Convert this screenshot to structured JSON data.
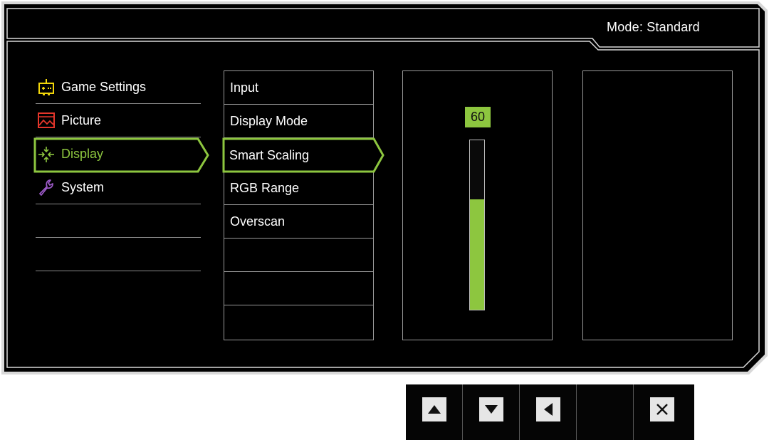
{
  "header": {
    "mode_label": "Mode: Standard"
  },
  "main_menu": {
    "items": [
      {
        "label": "Game Settings",
        "icon": "game-settings-icon",
        "selected": false
      },
      {
        "label": "Picture",
        "icon": "picture-icon",
        "selected": false
      },
      {
        "label": "Display",
        "icon": "display-icon",
        "selected": true
      },
      {
        "label": "System",
        "icon": "system-wrench-icon",
        "selected": false
      },
      {
        "label": "",
        "selected": false
      },
      {
        "label": "",
        "selected": false
      }
    ]
  },
  "sub_menu": {
    "items": [
      {
        "label": "Input"
      },
      {
        "label": "Display Mode"
      },
      {
        "label": "Smart Scaling",
        "selected": true
      },
      {
        "label": "RGB Range"
      },
      {
        "label": "Overscan"
      },
      {
        "label": ""
      },
      {
        "label": ""
      },
      {
        "label": ""
      }
    ]
  },
  "value_panel": {
    "value": "60",
    "level_fraction": 0.65
  },
  "control_bar": {
    "keys": [
      {
        "icon": "arrow-up-icon"
      },
      {
        "icon": "arrow-down-icon"
      },
      {
        "icon": "arrow-left-icon"
      },
      {
        "icon": ""
      },
      {
        "icon": "close-icon"
      }
    ]
  },
  "colors": {
    "accent": "#8dc63f",
    "background": "#000000",
    "border": "#9a9a9a"
  }
}
